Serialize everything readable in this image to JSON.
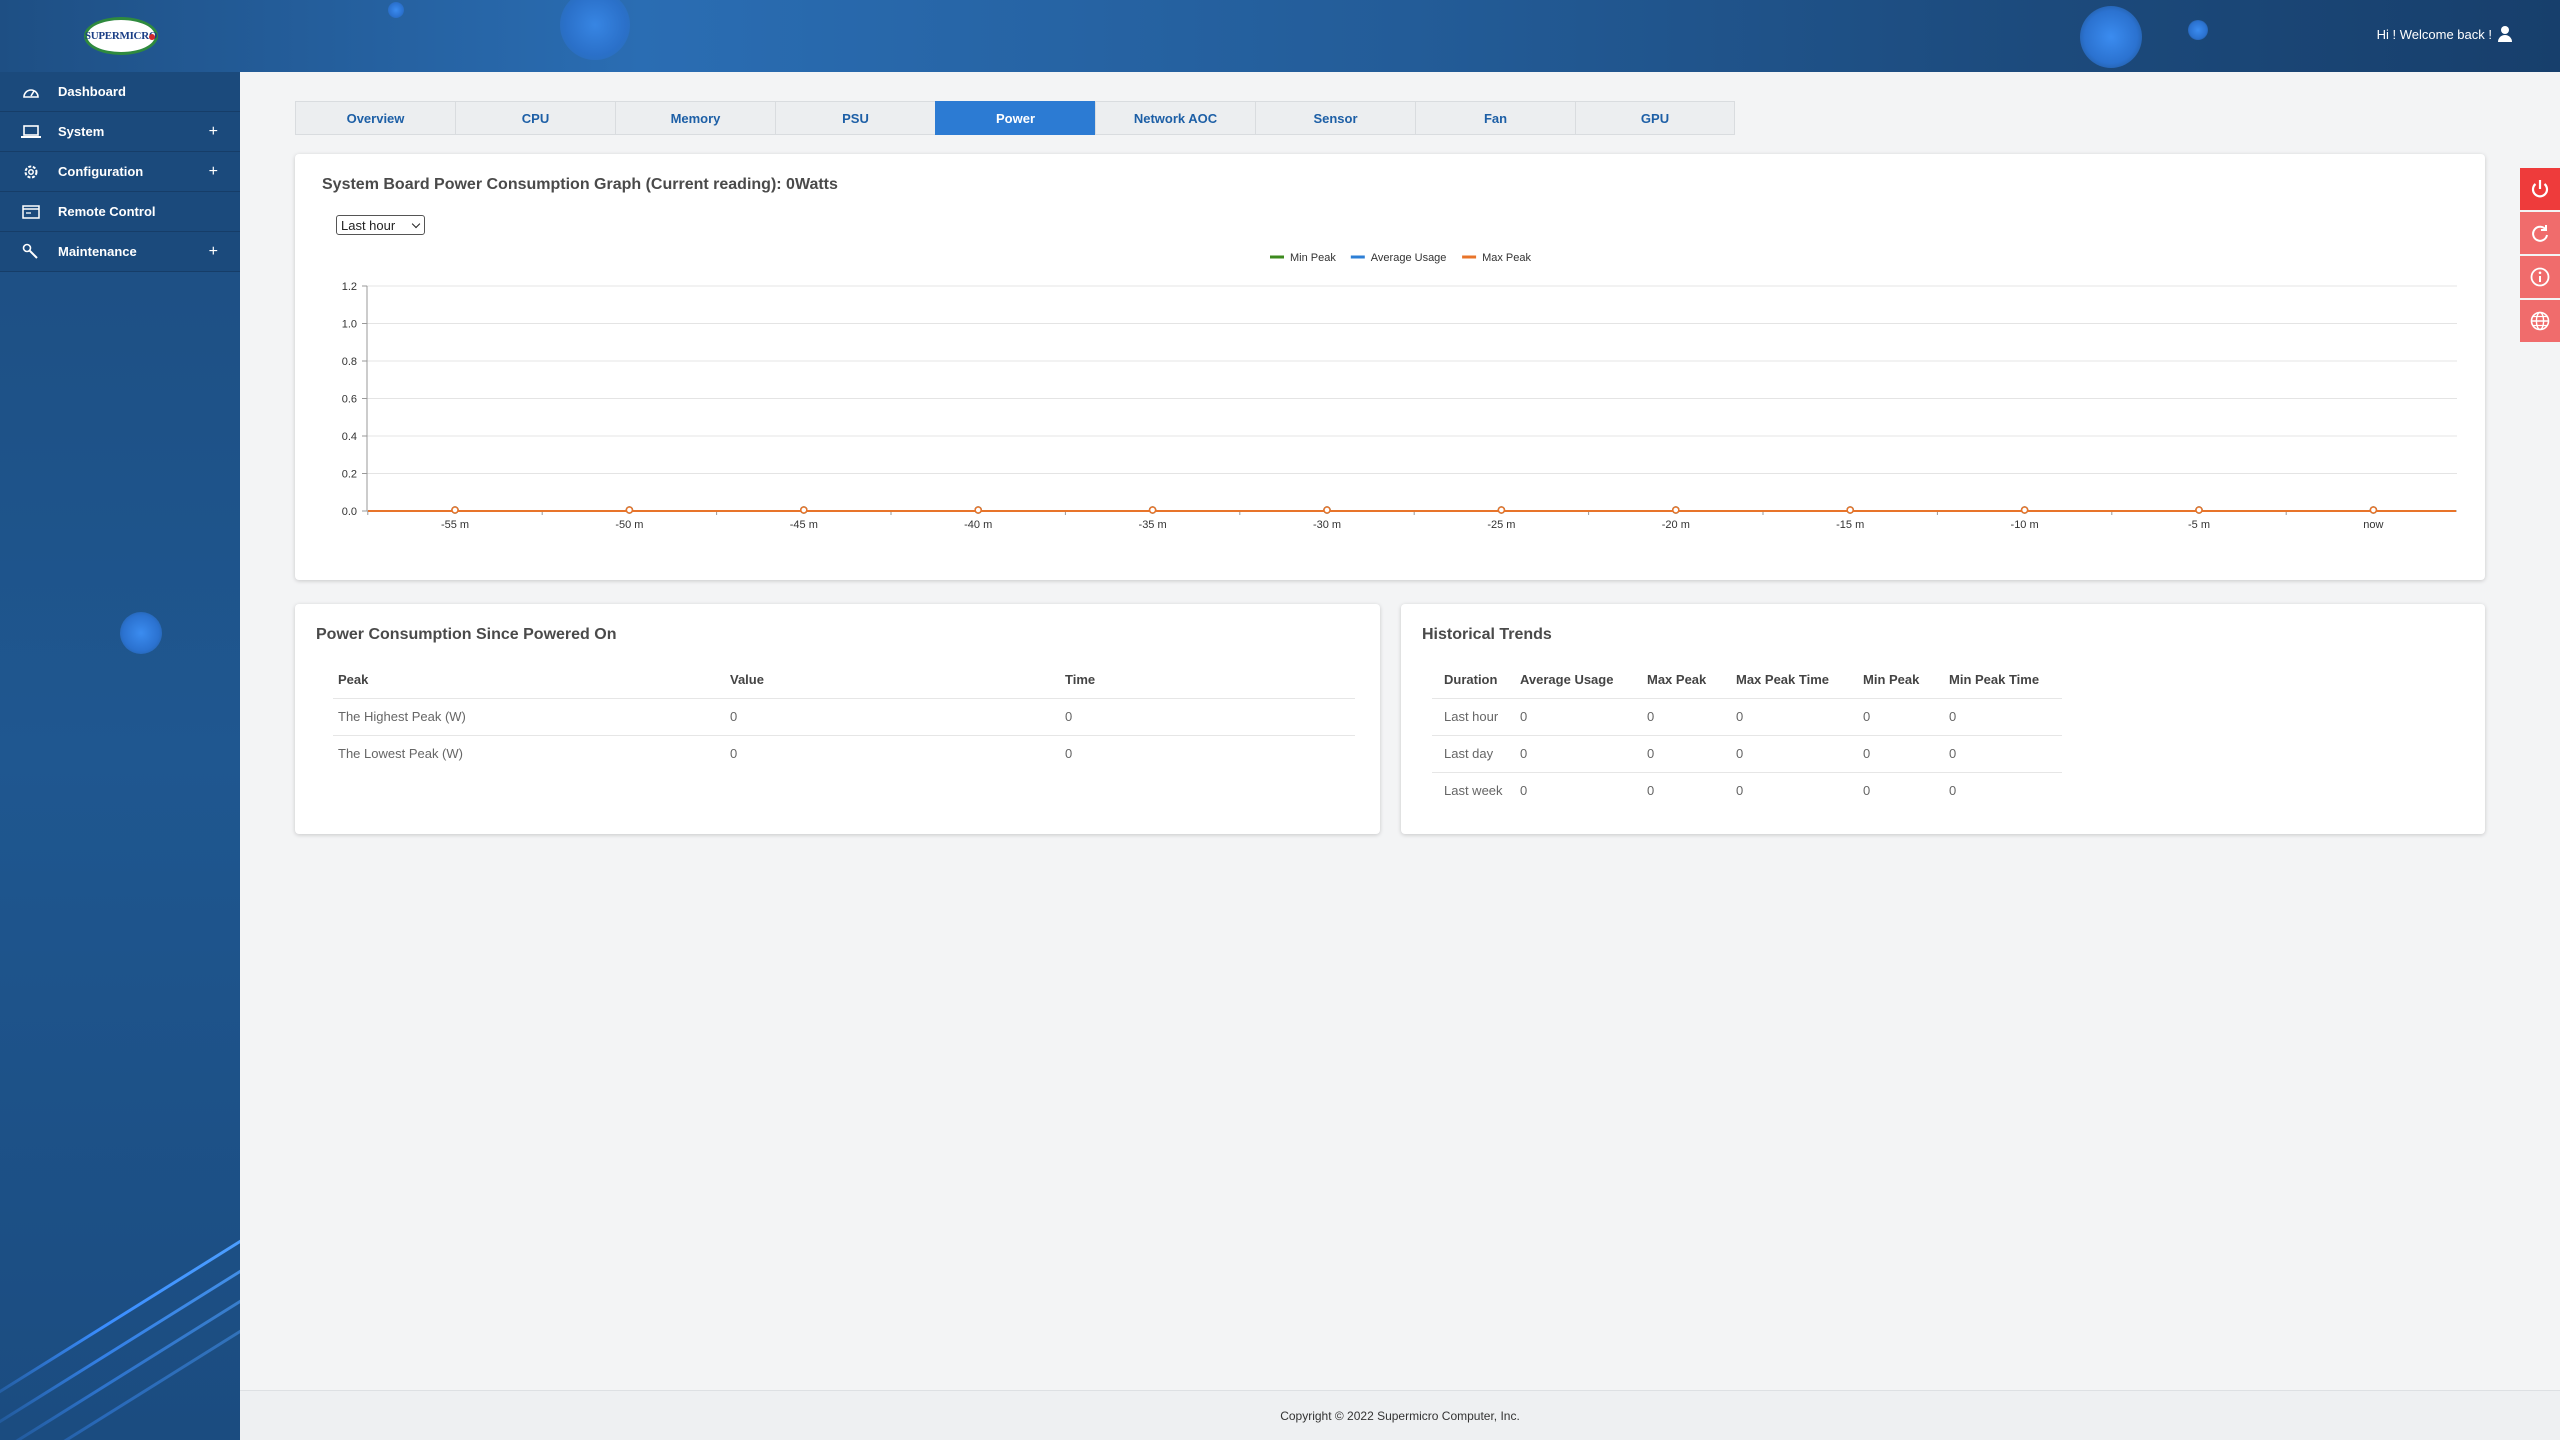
{
  "header": {
    "logo_text": "SUPERMICRO",
    "welcome": "Hi ! Welcome back !"
  },
  "sidebar": {
    "items": [
      {
        "label": "Dashboard",
        "icon": "dashboard-gauge-icon",
        "expandable": false
      },
      {
        "label": "System",
        "icon": "laptop-icon",
        "expandable": true
      },
      {
        "label": "Configuration",
        "icon": "gear-icon",
        "expandable": true
      },
      {
        "label": "Remote Control",
        "icon": "console-window-icon",
        "expandable": false
      },
      {
        "label": "Maintenance",
        "icon": "wrench-icon",
        "expandable": true
      }
    ],
    "expand_symbol": "+"
  },
  "tabs": [
    "Overview",
    "CPU",
    "Memory",
    "PSU",
    "Power",
    "Network AOC",
    "Sensor",
    "Fan",
    "GPU"
  ],
  "active_tab": "Power",
  "graph": {
    "title": "System Board Power Consumption Graph (Current reading): 0Watts",
    "range_select": "Last hour"
  },
  "chart_data": {
    "type": "line",
    "title": "",
    "x": [
      "-55 m",
      "-50 m",
      "-45 m",
      "-40 m",
      "-35 m",
      "-30 m",
      "-25 m",
      "-20 m",
      "-15 m",
      "-10 m",
      "-5 m",
      "now"
    ],
    "series": [
      {
        "name": "Min Peak",
        "color": "#3c8a1e",
        "values": [
          0,
          0,
          0,
          0,
          0,
          0,
          0,
          0,
          0,
          0,
          0,
          0
        ]
      },
      {
        "name": "Average Usage",
        "color": "#2d7fd6",
        "values": [
          0,
          0,
          0,
          0,
          0,
          0,
          0,
          0,
          0,
          0,
          0,
          0
        ]
      },
      {
        "name": "Max Peak",
        "color": "#e8742a",
        "values": [
          0,
          0,
          0,
          0,
          0,
          0,
          0,
          0,
          0,
          0,
          0,
          0
        ]
      }
    ],
    "yticks": [
      "0.0",
      "0.2",
      "0.4",
      "0.6",
      "0.8",
      "1.0",
      "1.2"
    ],
    "ylim": [
      0,
      1.2
    ],
    "grid": true,
    "legend": "top-center"
  },
  "since_powered": {
    "title": "Power Consumption Since Powered On",
    "headers": [
      "Peak",
      "Value",
      "Time"
    ],
    "rows": [
      [
        "The Highest Peak (W)",
        "0",
        "0"
      ],
      [
        "The Lowest Peak (W)",
        "0",
        "0"
      ]
    ]
  },
  "trends": {
    "title": "Historical Trends",
    "headers": [
      "Duration",
      "Average Usage",
      "Max Peak",
      "Max Peak Time",
      "Min Peak",
      "Min Peak Time"
    ],
    "rows": [
      [
        "Last hour",
        "0",
        "0",
        "0",
        "0",
        "0"
      ],
      [
        "Last day",
        "0",
        "0",
        "0",
        "0",
        "0"
      ],
      [
        "Last week",
        "0",
        "0",
        "0",
        "0",
        "0"
      ]
    ]
  },
  "actions": [
    {
      "icon": "power-icon"
    },
    {
      "icon": "refresh-icon"
    },
    {
      "icon": "info-icon"
    },
    {
      "icon": "globe-icon"
    }
  ],
  "footer": "Copyright © 2022 Supermicro Computer, Inc.",
  "colors": {
    "accent": "#2c7bd3",
    "header": "#1e4f84",
    "action_red": "#ee3b3b"
  }
}
